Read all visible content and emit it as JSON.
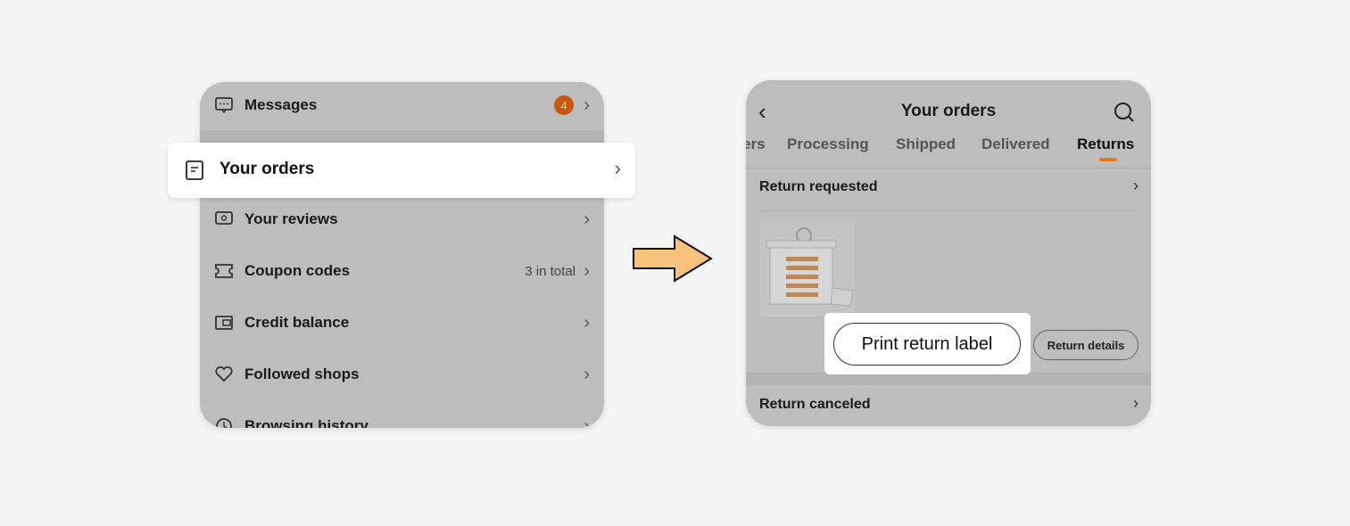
{
  "left_menu": {
    "messages": {
      "label": "Messages",
      "badge": "4",
      "icon": "message-icon"
    },
    "your_orders": {
      "label": "Your orders",
      "icon": "orders-icon"
    },
    "your_reviews": {
      "label": "Your reviews",
      "icon": "review-icon"
    },
    "coupon_codes": {
      "label": "Coupon codes",
      "extra": "3 in total",
      "icon": "coupon-icon"
    },
    "credit_balance": {
      "label": "Credit balance",
      "icon": "wallet-icon"
    },
    "followed_shops": {
      "label": "Followed shops",
      "icon": "heart-icon"
    },
    "browsing_history": {
      "label": "Browsing history",
      "icon": "clock-icon"
    }
  },
  "right_screen": {
    "title": "Your orders",
    "tabs": [
      {
        "label": "ers"
      },
      {
        "label": "Processing"
      },
      {
        "label": "Shipped"
      },
      {
        "label": "Delivered"
      },
      {
        "label": "Returns",
        "active": true
      }
    ],
    "section_requested": "Return requested",
    "print_button": "Print return label",
    "details_button": "Return details",
    "section_canceled": "Return canceled"
  },
  "colors": {
    "accent": "#e07a1a",
    "arrow_fill": "#f6c27e",
    "badge": "#c85a10"
  }
}
